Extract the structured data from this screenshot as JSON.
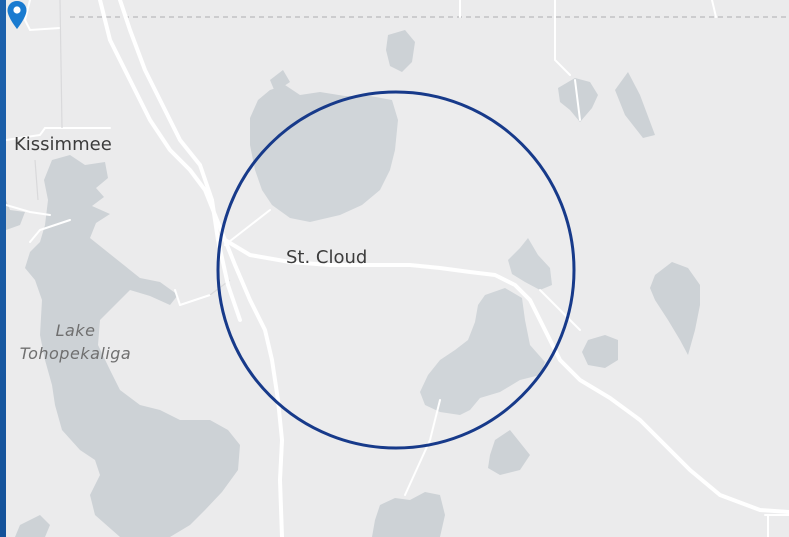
{
  "map": {
    "places": {
      "kissimmee": "Kissimmee",
      "st_cloud": "St. Cloud"
    },
    "water": {
      "lake_line1": "Lake",
      "lake_line2": "Tohopekaliga"
    },
    "radius_circle_color": "#173a8a",
    "pin_color": "#1a7bd0",
    "frame_color": "#1e5fa8"
  }
}
